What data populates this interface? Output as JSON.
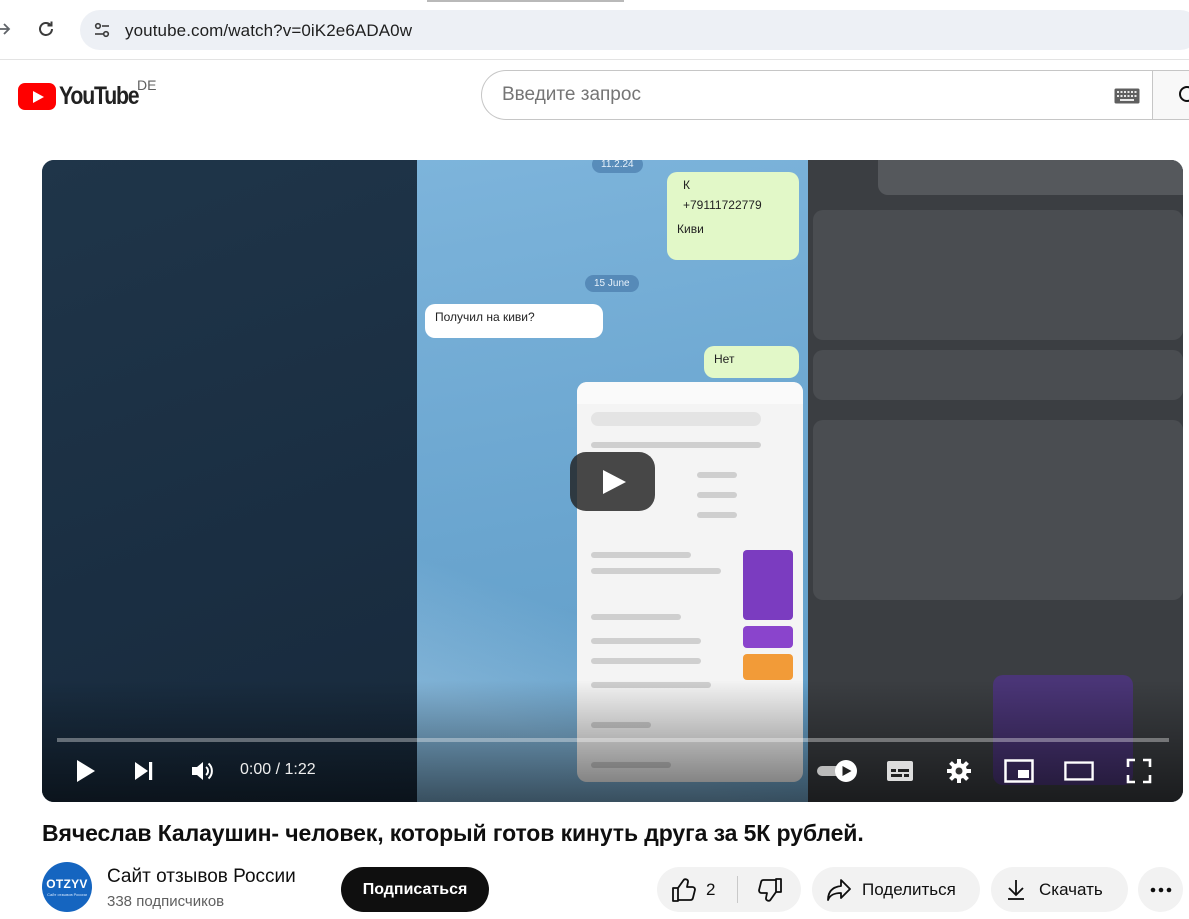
{
  "browser": {
    "url": "youtube.com/watch?v=0iK2e6ADA0w"
  },
  "header": {
    "logo_text": "YouTube",
    "country_code": "DE",
    "search_placeholder": "Введите запрос"
  },
  "player": {
    "current_time": "0:00",
    "duration": "1:22",
    "time_display": "0:00 / 1:22",
    "progress_fraction": 0,
    "frame": {
      "contact_name": "К",
      "phone_number": "+79111722779",
      "payment_word": "Киви",
      "date_pill": "15 June",
      "message_in": "Получил на киви?",
      "message_out": "Нет"
    }
  },
  "video": {
    "title": "Вячеслав Калаушин- человек, который готов кинуть друга за 5К рублей."
  },
  "channel": {
    "name": "Сайт отзывов России",
    "subscribers": "338 подписчиков",
    "avatar_text": "OTZYV",
    "avatar_subtext": "Сайт отзывов России",
    "subscribe_label": "Подписаться"
  },
  "actions": {
    "like_count": "2",
    "share_label": "Поделиться",
    "download_label": "Скачать"
  },
  "colors": {
    "youtube_red": "#ff0000",
    "subscribe_bg": "#0f0f0f",
    "pill_bg": "#f2f2f2",
    "omnibox_bg": "#edf0f5"
  }
}
